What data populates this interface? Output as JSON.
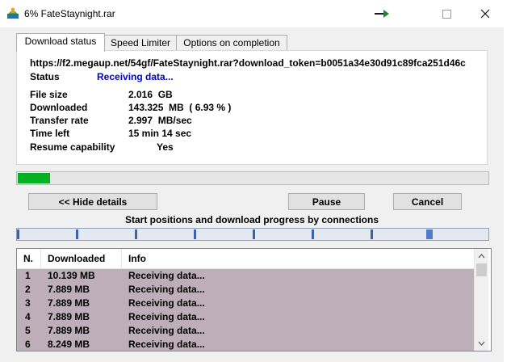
{
  "window": {
    "title": "6% FateStaynight.rar"
  },
  "tabs": [
    {
      "label": "Download status"
    },
    {
      "label": "Speed Limiter"
    },
    {
      "label": "Options on completion"
    }
  ],
  "status": {
    "url": "https://f2.megaup.net/54gf/FateStaynight.rar?download_token=b0051a34e30d91c89fca251d46c",
    "status_label": "Status",
    "status_value": "Receiving data...",
    "file_size_label": "File size",
    "file_size_value": "2.016  GB",
    "downloaded_label": "Downloaded",
    "downloaded_value": "143.325  MB  ( 6.93 % )",
    "rate_label": "Transfer rate",
    "rate_value": "2.997  MB/sec",
    "time_label": "Time left",
    "time_value": "15 min 14 sec",
    "resume_label": "Resume capability",
    "resume_value": "Yes"
  },
  "progress": {
    "fraction": 0.0693
  },
  "buttons": {
    "hide_details": "<< Hide details",
    "pause": "Pause",
    "cancel": "Cancel"
  },
  "connections": {
    "title": "Start positions and download progress by connections",
    "count": 8
  },
  "list": {
    "headers": [
      "N.",
      "Downloaded",
      "Info"
    ],
    "rows": [
      {
        "n": "1",
        "downloaded": "10.139  MB",
        "info": "Receiving data..."
      },
      {
        "n": "2",
        "downloaded": "7.889  MB",
        "info": "Receiving data..."
      },
      {
        "n": "3",
        "downloaded": "7.889  MB",
        "info": "Receiving data..."
      },
      {
        "n": "4",
        "downloaded": "7.889  MB",
        "info": "Receiving data..."
      },
      {
        "n": "5",
        "downloaded": "7.889  MB",
        "info": "Receiving data..."
      },
      {
        "n": "6",
        "downloaded": "8.249  MB",
        "info": "Receiving data..."
      }
    ]
  },
  "colors": {
    "progress_fill": "#06b025",
    "status_text": "#0000cc",
    "list_highlight": "#bdaeb9"
  },
  "icons": {
    "app": "idm-download-icon",
    "minimize": "minimize-arrow-icon",
    "maximize": "maximize-icon",
    "close": "close-icon"
  }
}
